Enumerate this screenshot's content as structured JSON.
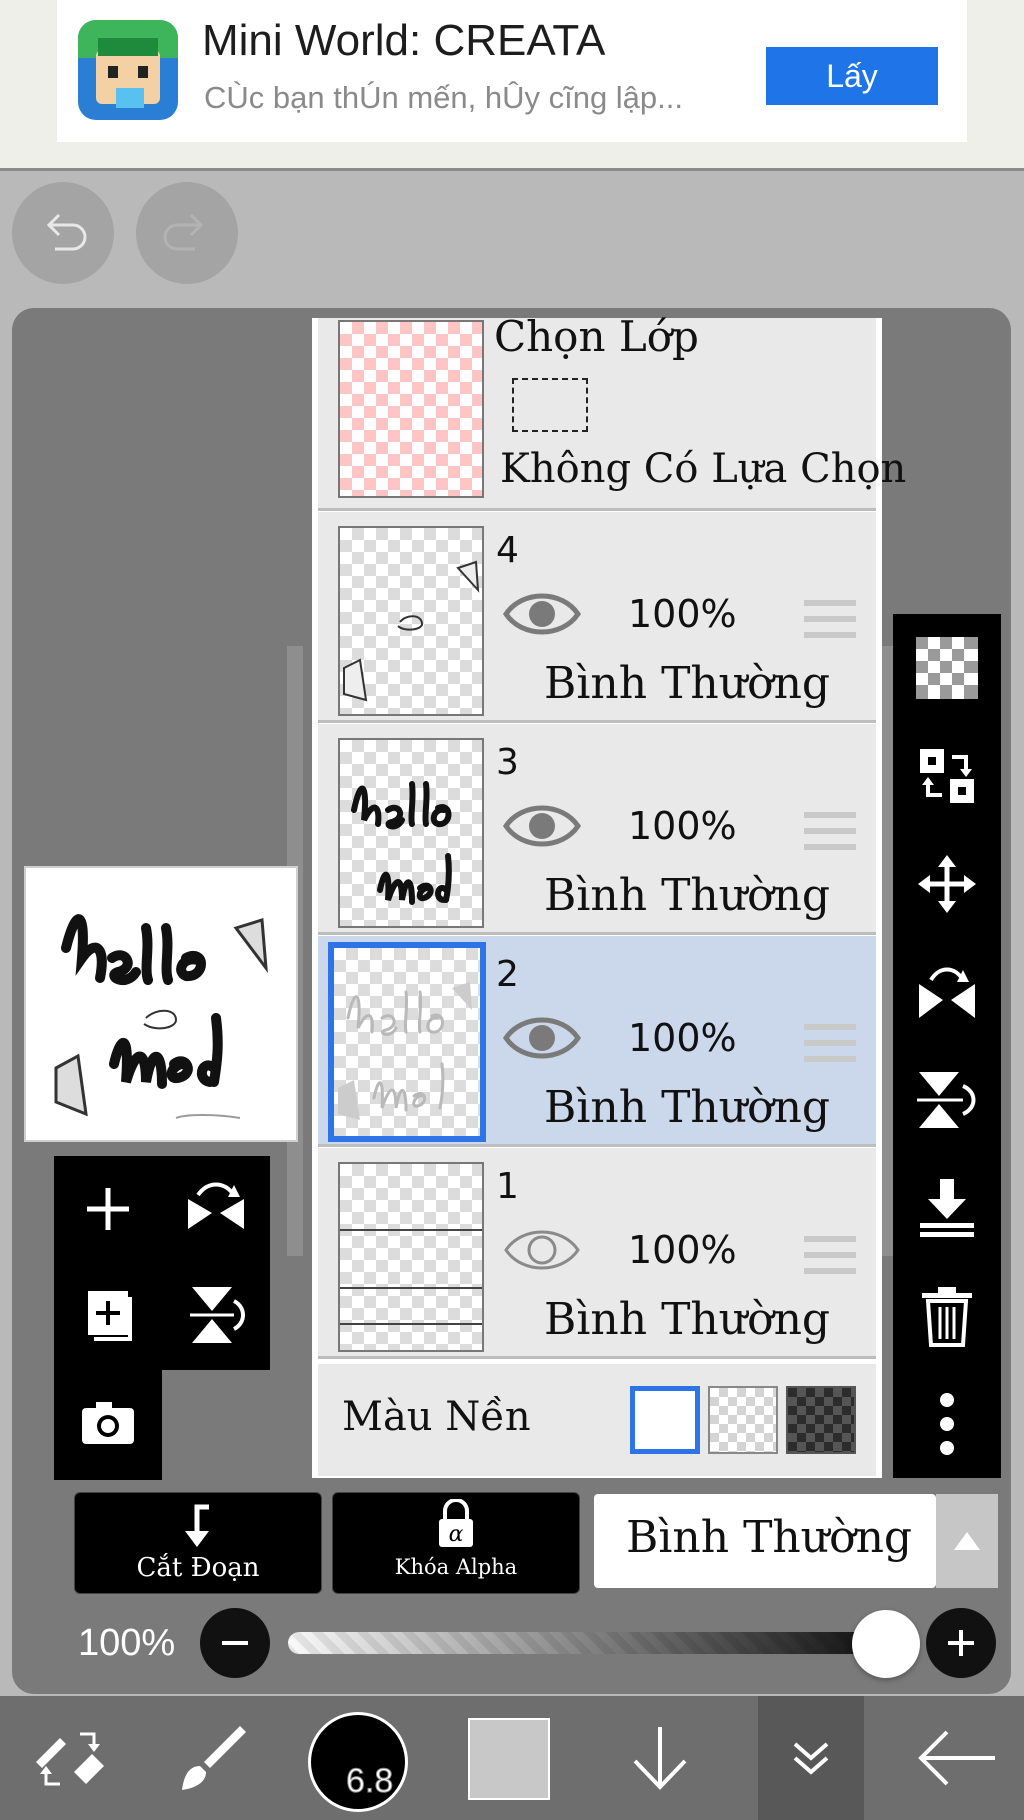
{
  "ad": {
    "title": "Mini World: CREATA",
    "subtitle": "CÙc bạn thÚn mến, hÛy cĩng lập...",
    "button": "Lấy"
  },
  "icons": {
    "undo": "undo-icon",
    "redo": "redo-icon"
  },
  "layer_panel": {
    "selection_layer": {
      "title": "Chọn Lớp",
      "status": "Không Có Lựa Chọn"
    },
    "layers": [
      {
        "number": "4",
        "opacity": "100%",
        "blend": "Bình Thường",
        "visible": true,
        "selected": false
      },
      {
        "number": "3",
        "opacity": "100%",
        "blend": "Bình Thường",
        "visible": true,
        "selected": false
      },
      {
        "number": "2",
        "opacity": "100%",
        "blend": "Bình Thường",
        "visible": true,
        "selected": true
      },
      {
        "number": "1",
        "opacity": "100%",
        "blend": "Bình Thường",
        "visible": false,
        "selected": false
      }
    ],
    "background": {
      "label": "Màu Nền",
      "options": [
        "white",
        "checker",
        "dark-checker"
      ],
      "selected": "white"
    }
  },
  "layer_options": {
    "clip_label": "Cắt Đoạn",
    "alpha_lock_label": "Khóa Alpha",
    "blend_mode": "Bình Thường"
  },
  "opacity": {
    "label": "100%",
    "value": 1.0
  },
  "brush": {
    "size": "6.8"
  },
  "colors": {
    "accent": "#2f74e6",
    "ad_button": "#1f74e7",
    "selected_row": "#cbd7ea",
    "current_color": "#c8c8c8"
  }
}
